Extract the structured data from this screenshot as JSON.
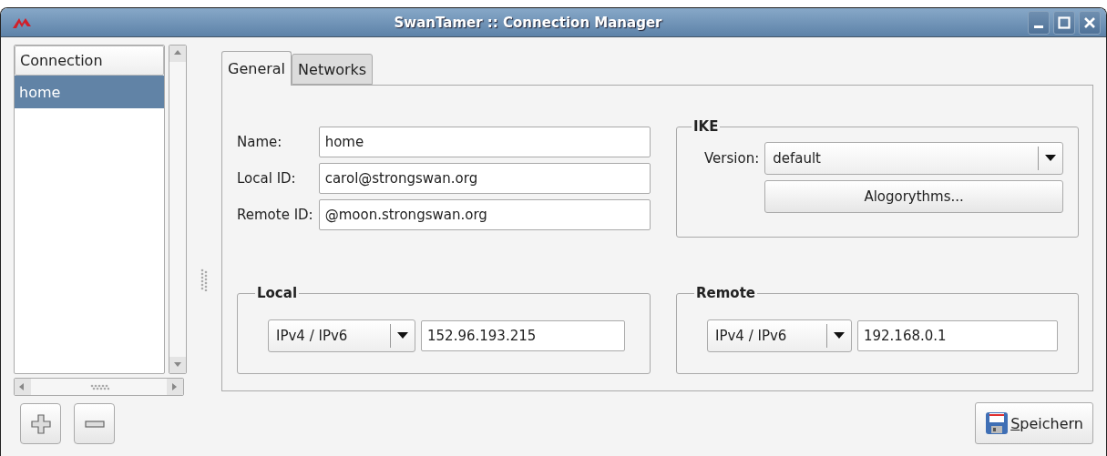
{
  "window": {
    "title": "SwanTamer :: Connection Manager"
  },
  "connection_list": {
    "header": "Connection",
    "items": [
      {
        "label": "home",
        "selected": true
      }
    ]
  },
  "tabs": [
    {
      "label": "General",
      "selected": true
    },
    {
      "label": "Networks",
      "selected": false
    }
  ],
  "general": {
    "fields": [
      {
        "label": "Name:",
        "value": "home"
      },
      {
        "label": "Local ID:",
        "value": "carol@strongswan.org"
      },
      {
        "label": "Remote ID:",
        "value": "@moon.strongswan.org"
      }
    ],
    "ike": {
      "title": "IKE",
      "version_label": "Version:",
      "version": "default",
      "algorithms_button": "Alogorythms..."
    },
    "endpoints": [
      {
        "title": "Local",
        "address_family": "IPv4 / IPv6",
        "address": "152.96.193.215"
      },
      {
        "title": "Remote",
        "address_family": "IPv4 / IPv6",
        "address": "192.168.0.1"
      }
    ]
  },
  "save_button": {
    "label": "Speichern",
    "mnemonic": true
  }
}
